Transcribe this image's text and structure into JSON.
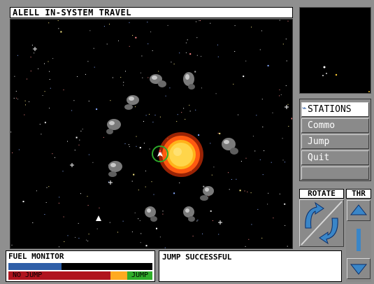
{
  "title": "ALELL IN-SYSTEM TRAVEL",
  "menu": {
    "items": [
      {
        "label": "STATIONS",
        "icon": "satellite-icon",
        "active": true
      },
      {
        "label": "Commo",
        "active": false
      },
      {
        "label": "Jump",
        "active": false
      },
      {
        "label": "Quit",
        "active": false
      }
    ]
  },
  "controls": {
    "rotate_label": "ROTATE",
    "thrust_label": "THR",
    "thrust_level_glyph": "1"
  },
  "fuel": {
    "title": "FUEL MONITOR",
    "level_fraction": 0.37,
    "no_jump_label": "NO JUMP",
    "jump_label": "JUMP"
  },
  "message": "JUMP SUCCESSFUL",
  "colors": {
    "panel_gray": "#8a8a8a",
    "sun_core": "#ffc21f",
    "sun_corona": "#ff5a10",
    "ship_ring": "#2ea82a",
    "thrust_blue": "#3a86c8",
    "fuel_blue": "#2f5fa8",
    "no_jump_red": "#b0141e",
    "jump_green": "#2fae2a",
    "warn_orange": "#ffaa20"
  },
  "icons": [
    "sun-icon",
    "asteroid-icon",
    "player-ship-icon",
    "satellite-icon",
    "rotate-left-arrow-icon",
    "rotate-right-arrow-icon",
    "thrust-up-arrow-icon",
    "thrust-down-arrow-icon"
  ]
}
